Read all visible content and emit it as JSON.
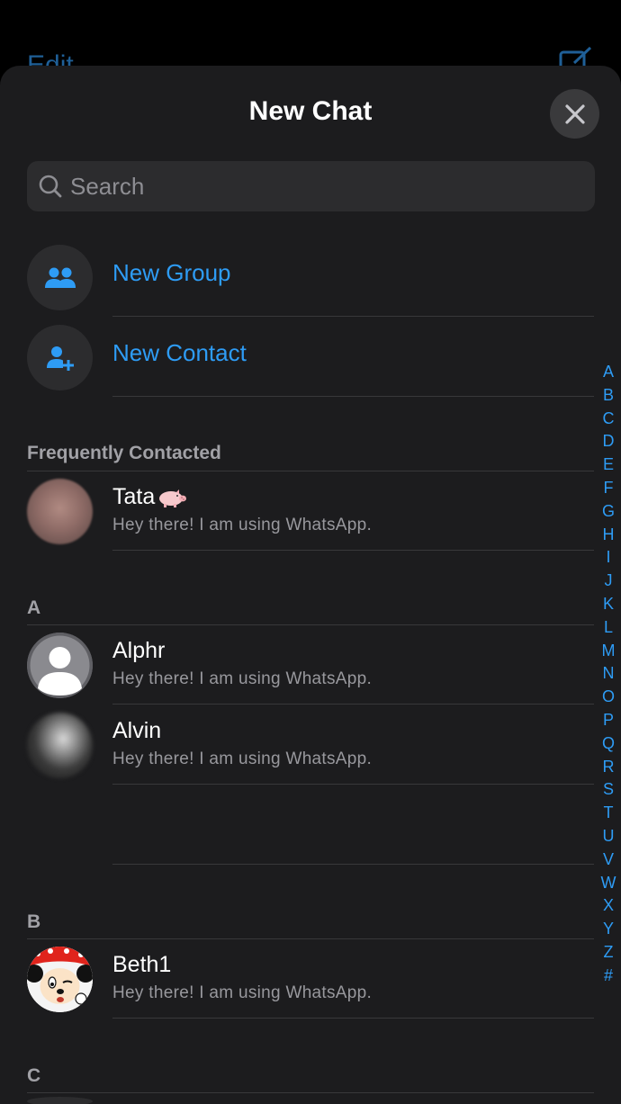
{
  "background": {
    "edit_label": "Edit"
  },
  "sheet": {
    "title": "New Chat"
  },
  "search": {
    "placeholder": "Search"
  },
  "actions": [
    {
      "label": "New Group",
      "icon": "group-icon"
    },
    {
      "label": "New Contact",
      "icon": "add-contact-icon"
    }
  ],
  "sections": {
    "frequent": {
      "header": "Frequently Contacted",
      "contacts": [
        {
          "name": "Tata",
          "status": "Hey there! I am using WhatsApp.",
          "avatar": "blurred-photo",
          "emoji": "pig-icon"
        }
      ]
    },
    "a": {
      "header": "A",
      "contacts": [
        {
          "name": "Alphr",
          "status": "Hey there! I am using WhatsApp.",
          "avatar": "default-person-icon"
        },
        {
          "name": "Alvin",
          "status": "Hey there! I am using WhatsApp.",
          "avatar": "blurred-photo"
        }
      ]
    },
    "b": {
      "header": "B",
      "contacts": [
        {
          "name": "Beth1",
          "status": "Hey there! I am using WhatsApp.",
          "avatar": "cartoon-mouse-photo"
        }
      ]
    },
    "c": {
      "header": "C"
    }
  },
  "index": [
    "A",
    "B",
    "C",
    "D",
    "E",
    "F",
    "G",
    "H",
    "I",
    "J",
    "K",
    "L",
    "M",
    "N",
    "O",
    "P",
    "Q",
    "R",
    "S",
    "T",
    "U",
    "V",
    "W",
    "X",
    "Y",
    "Z",
    "#"
  ],
  "colors": {
    "accent": "#2e9cf5",
    "sheet_background": "#1c1c1e",
    "secondary_text": "#98989d",
    "section_header": "#a1a1a6"
  }
}
